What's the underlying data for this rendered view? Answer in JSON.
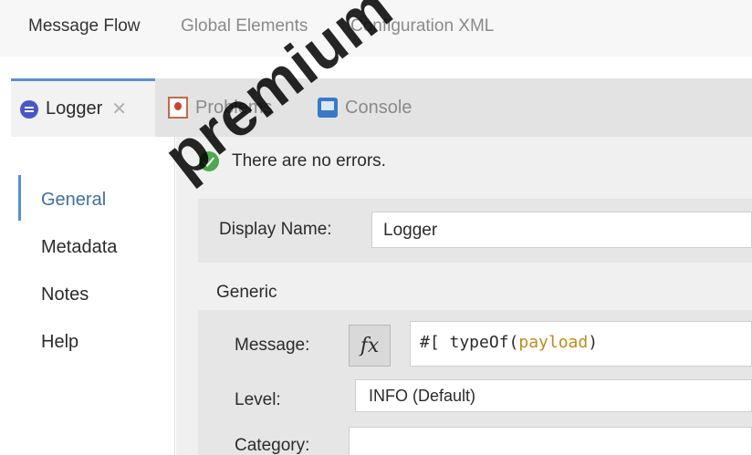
{
  "editor_tabs": [
    {
      "label": "Message Flow",
      "active": true
    },
    {
      "label": "Global Elements",
      "active": false
    },
    {
      "label": "Configuration XML",
      "active": false
    }
  ],
  "view_tabs": {
    "logger": {
      "label": "Logger",
      "icon": "logger-icon",
      "active": true
    },
    "problems": {
      "label": "Problems",
      "icon": "problems-icon"
    },
    "console": {
      "label": "Console",
      "icon": "console-icon"
    }
  },
  "nav": {
    "general": "General",
    "metadata": "Metadata",
    "notes": "Notes",
    "help": "Help"
  },
  "status": {
    "text": "There are no errors.",
    "icon": "check-icon"
  },
  "display_name": {
    "label": "Display Name:",
    "value": "Logger"
  },
  "generic": {
    "section_label": "Generic",
    "message_label": "Message:",
    "fx_label": "fx",
    "message_prefix": "#[ typeOf(",
    "message_arg": "payload",
    "message_suffix": ")",
    "level_label": "Level:",
    "level_value": "INFO (Default)",
    "category_label": "Category:",
    "category_value": ""
  },
  "watermark": "premium",
  "colors": {
    "accent": "#5b8fd0",
    "payload_keyword": "#c08a1a",
    "logger_icon": "#4a56c8",
    "ok_icon": "#4ea84e"
  }
}
